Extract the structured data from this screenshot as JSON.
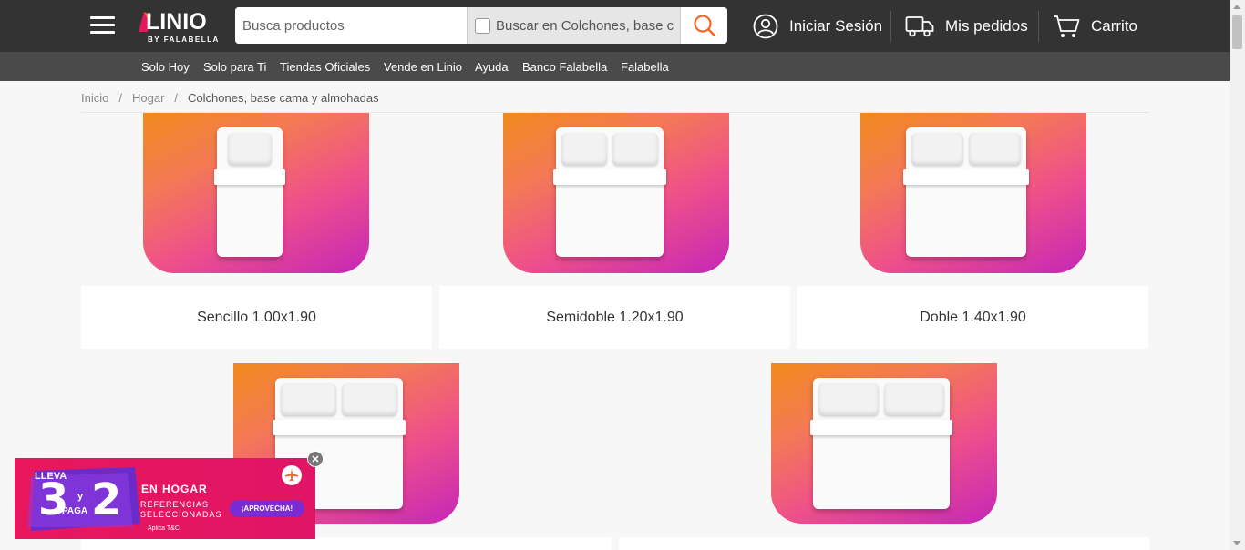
{
  "header": {
    "logo_text": "LINIO",
    "logo_tagline": "BY FALABELLA",
    "search_placeholder": "Busca productos",
    "search_scope_label": "Buscar en Colchones, base cama y almohadas",
    "login_label": "Iniciar Sesión",
    "orders_label": "Mis pedidos",
    "cart_label": "Carrito",
    "brand_color": "#e8175d",
    "accent_color": "#f26522"
  },
  "subnav": {
    "items": [
      "Solo Hoy",
      "Solo para Ti",
      "Tiendas Oficiales",
      "Vende en Linio",
      "Ayuda",
      "Banco Falabella",
      "Falabella"
    ]
  },
  "breadcrumb": {
    "items": [
      "Inicio",
      "Hogar",
      "Colchones, base cama y almohadas"
    ]
  },
  "categories": [
    {
      "label": "Sencillo 1.00x1.90",
      "icon": "single-bed-icon"
    },
    {
      "label": "Semidoble 1.20x1.90",
      "icon": "semidouble-bed-icon"
    },
    {
      "label": "Doble 1.40x1.90",
      "icon": "double-bed-icon"
    },
    {
      "label": "",
      "icon": "queen-bed-icon"
    },
    {
      "label": "",
      "icon": "king-bed-icon"
    }
  ],
  "promo": {
    "lleva": "LLEVA",
    "num_take": "3",
    "y": "y",
    "paga": "PAGA",
    "num_pay": "2",
    "headline": "EN HOGAR",
    "line1": "REFERENCIAS",
    "line2": "SELECCIONADAS",
    "cta": "¡APROVECHA!",
    "terms": "Aplica T&C.",
    "color": "#e8175d",
    "cta_color": "#7a2bd1"
  }
}
